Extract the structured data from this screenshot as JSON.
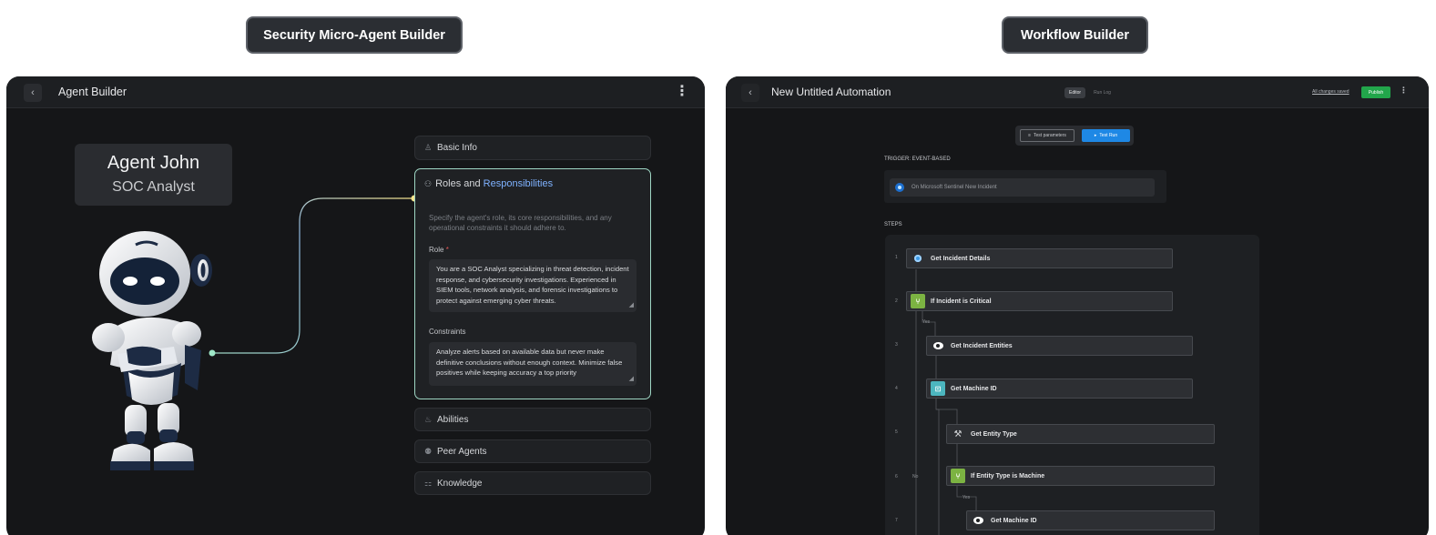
{
  "headers": {
    "left_title": "Security Micro-Agent Builder",
    "right_title": "Workflow Builder"
  },
  "agent_builder": {
    "back_label": "‹",
    "title": "Agent Builder",
    "menu_label": "⋮",
    "agent": {
      "name": "Agent John",
      "role": "SOC Analyst"
    },
    "sections": {
      "basic_info": "Basic Info",
      "roles_prefix": "Roles and ",
      "roles_highlight": "Responsibilities",
      "abilities": "Abilities",
      "peer_agents": "Peer Agents",
      "knowledge": "Knowledge"
    },
    "roles": {
      "description": "Specify the agent's role, its core responsibilities, and any operational constraints it should adhere to.",
      "role_label": "Role",
      "required_mark": "*",
      "role_value": "You are a SOC Analyst specializing in threat detection, incident response, and cybersecurity investigations. Experienced in SIEM tools, network analysis, and forensic investigations to protect against emerging cyber threats.",
      "constraints_label": "Constraints",
      "constraints_value": "Analyze alerts based on available data but never make definitive conclusions without enough context. Minimize false positives while keeping accuracy a top priority"
    }
  },
  "workflow_builder": {
    "back_label": "‹",
    "title": "New Untitled Automation",
    "tabs": [
      "Editor",
      "Run Log"
    ],
    "saved_text": "All changes saved",
    "publish_label": "Publish",
    "menu_label": "⋮",
    "test_parameters_label": "Test parameters",
    "test_run_label": "Test Run",
    "trigger_label": "TRIGGER: EVENT-BASED",
    "trigger_text": "On Microsoft Sentinel New Incident",
    "steps_label": "STEPS",
    "steps": [
      {
        "num": "1",
        "label": "Get Incident Details",
        "icon": "sentinel-icon"
      },
      {
        "num": "2",
        "label": "If Incident is Critical",
        "icon": "branch-icon"
      },
      {
        "num": "3",
        "label": "Get Incident Entities",
        "icon": "eye-icon"
      },
      {
        "num": "4",
        "label": "Get Machine ID",
        "icon": "machine-icon"
      },
      {
        "num": "5",
        "label": "Get Entity Type",
        "icon": "wrench-icon"
      },
      {
        "num": "6",
        "label": "If Entity Type is Machine",
        "icon": "branch-icon"
      },
      {
        "num": "7",
        "label": "Get Machine ID",
        "icon": "eye-icon"
      }
    ],
    "branch_labels": {
      "yes1": "Yes",
      "no": "No",
      "yes2": "Yes"
    }
  },
  "colors": {
    "accent_green": "#22a64b",
    "accent_blue": "#1e88e5",
    "connector_teal": "#9fd6c4",
    "connector_yellow": "#f1e08a"
  }
}
